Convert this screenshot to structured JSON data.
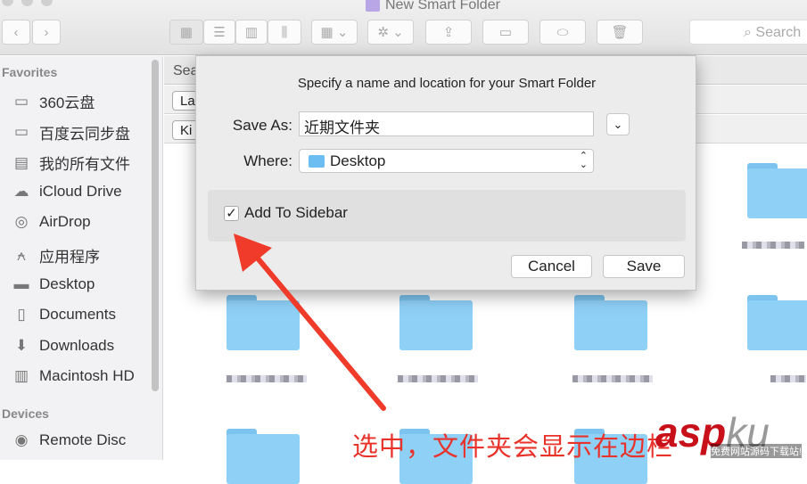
{
  "window": {
    "title": "New Smart Folder"
  },
  "toolbar": {
    "back": "‹",
    "forward": "›",
    "search_placeholder": "Search"
  },
  "sidebar": {
    "favorites_label": "Favorites",
    "items": [
      {
        "label": "360云盘",
        "icon": "folder-icon"
      },
      {
        "label": "百度云同步盘",
        "icon": "folder-icon"
      },
      {
        "label": "我的所有文件",
        "icon": "all-files-icon"
      },
      {
        "label": "iCloud Drive",
        "icon": "cloud-icon"
      },
      {
        "label": "AirDrop",
        "icon": "airdrop-icon"
      },
      {
        "label": "应用程序",
        "icon": "applications-icon"
      },
      {
        "label": "Desktop",
        "icon": "desktop-icon"
      },
      {
        "label": "Documents",
        "icon": "documents-icon"
      },
      {
        "label": "Downloads",
        "icon": "downloads-icon"
      },
      {
        "label": "Macintosh HD",
        "icon": "disk-icon"
      }
    ],
    "devices_label": "Devices",
    "devices": [
      {
        "label": "Remote Disc",
        "icon": "disc-icon"
      }
    ]
  },
  "main": {
    "search_bar": "Sea",
    "criteria": [
      "La",
      "Ki"
    ]
  },
  "dialog": {
    "title": "Specify a name and location for your Smart Folder",
    "save_as_label": "Save As:",
    "save_as_value": "近期文件夹",
    "where_label": "Where:",
    "where_value": "Desktop",
    "add_to_sidebar_label": "Add To Sidebar",
    "add_to_sidebar_checked": true,
    "cancel": "Cancel",
    "save": "Save"
  },
  "annotation": {
    "text": "选中，文件夹会显示在边栏",
    "color": "#e8322a"
  },
  "watermark": {
    "text": "aspku.com",
    "subtitle": "免费网站源码下载站!"
  }
}
